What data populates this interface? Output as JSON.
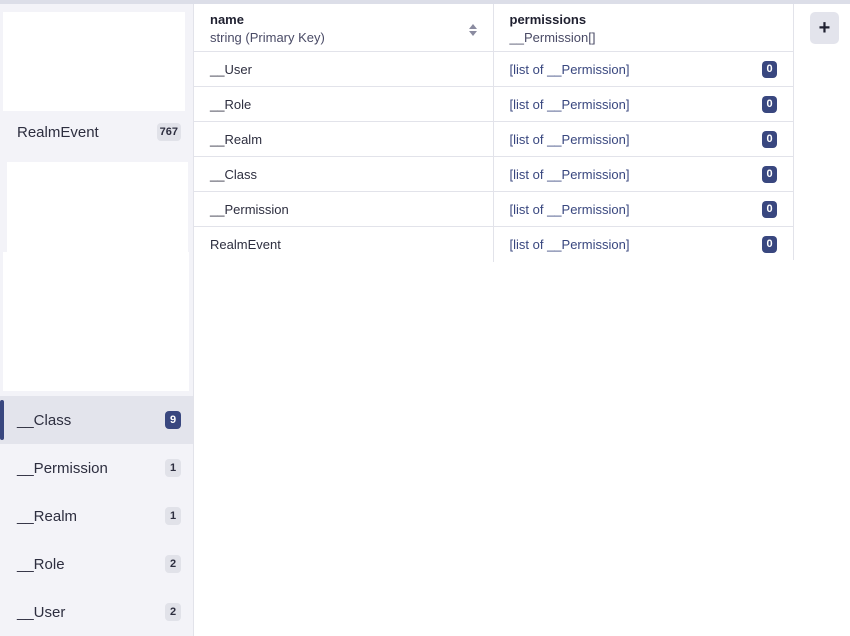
{
  "sidebar": {
    "items": [
      {
        "label": "RealmEvent",
        "count": "767"
      },
      {
        "label": "__Class",
        "count": "9"
      },
      {
        "label": "__Permission",
        "count": "1"
      },
      {
        "label": "__Realm",
        "count": "1"
      },
      {
        "label": "__Role",
        "count": "2"
      },
      {
        "label": "__User",
        "count": "2"
      }
    ]
  },
  "table": {
    "columns": [
      {
        "name": "name",
        "type": "string (Primary Key)"
      },
      {
        "name": "permissions",
        "type": "__Permission[]"
      }
    ],
    "rows": [
      {
        "name": "__User",
        "permissions": "[list of __Permission]",
        "count": "0"
      },
      {
        "name": "__Role",
        "permissions": "[list of __Permission]",
        "count": "0"
      },
      {
        "name": "__Realm",
        "permissions": "[list of __Permission]",
        "count": "0"
      },
      {
        "name": "__Class",
        "permissions": "[list of __Permission]",
        "count": "0"
      },
      {
        "name": "__Permission",
        "permissions": "[list of __Permission]",
        "count": "0"
      },
      {
        "name": "RealmEvent",
        "permissions": "[list of __Permission]",
        "count": "0"
      }
    ]
  },
  "toolbar": {
    "add_label": "+"
  },
  "colors": {
    "accent": "#39477f",
    "sidebar_bg": "#f3f3f8",
    "active_bg": "#e3e4ec"
  }
}
